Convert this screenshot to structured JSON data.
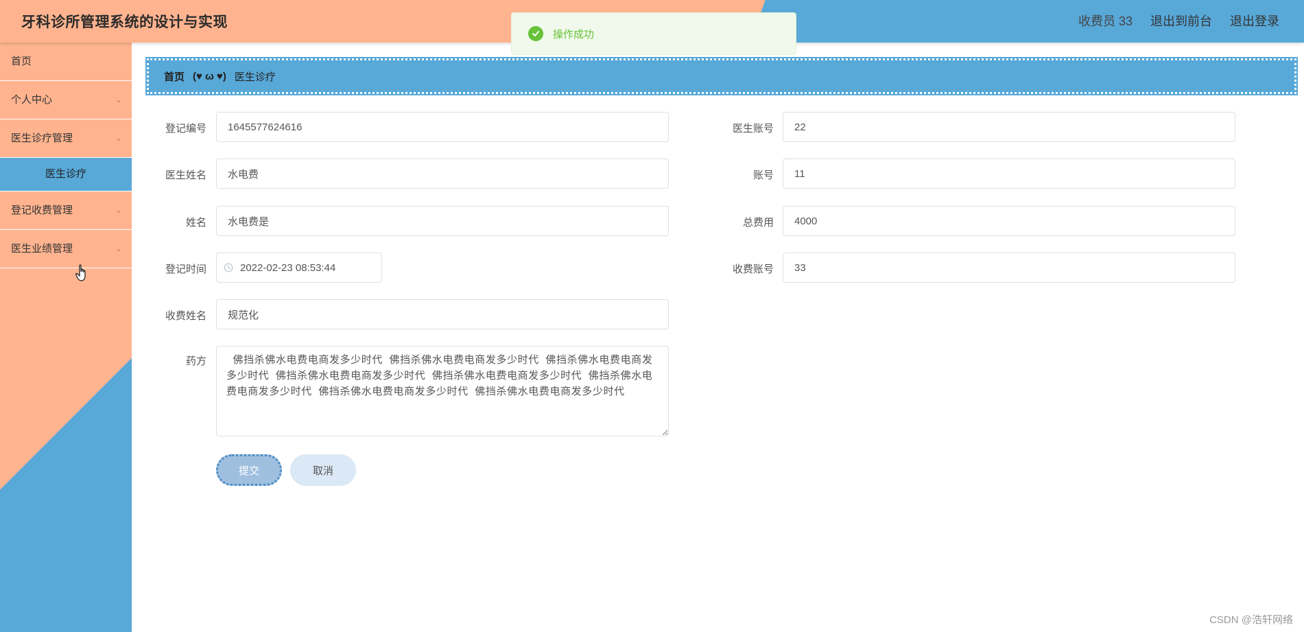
{
  "header": {
    "title": "牙科诊所管理系统的设计与实现",
    "user_label": "收费员 33",
    "back_to_front": "退出到前台",
    "logout": "退出登录"
  },
  "toast": {
    "message": "操作成功"
  },
  "sidebar": {
    "items": [
      {
        "label": "首页"
      },
      {
        "label": "个人中心",
        "chevron": "chevron-down-icon"
      },
      {
        "label": "医生诊疗管理",
        "chevron": "chevron-down-icon",
        "expanded": true
      },
      {
        "label": "登记收费管理",
        "chevron": "chevron-down-icon"
      },
      {
        "label": "医生业绩管理",
        "chevron": "chevron-down-icon"
      }
    ],
    "submenu": {
      "active_label": "医生诊疗"
    }
  },
  "breadcrumb": {
    "home": "首页",
    "separator": "(♥ ω ♥)",
    "current": "医生诊疗"
  },
  "form": {
    "registration_no": {
      "label": "登记编号",
      "value": "1645577624616"
    },
    "doctor_account": {
      "label": "医生账号",
      "value": "22"
    },
    "doctor_name": {
      "label": "医生姓名",
      "value": "水电费"
    },
    "account": {
      "label": "账号",
      "value": "11"
    },
    "name": {
      "label": "姓名",
      "value": "水电费是"
    },
    "total_cost": {
      "label": "总费用",
      "value": "4000"
    },
    "registration_time": {
      "label": "登记时间",
      "value": "2022-02-23 08:53:44"
    },
    "cashier_account": {
      "label": "收费账号",
      "value": "33"
    },
    "cashier_name": {
      "label": "收费姓名",
      "value": "规范化"
    },
    "prescription": {
      "label": "药方",
      "value": "  佛挡杀佛水电费电商发多少时代  佛挡杀佛水电费电商发多少时代  佛挡杀佛水电费电商发多少时代  佛挡杀佛水电费电商发多少时代  佛挡杀佛水电费电商发多少时代  佛挡杀佛水电费电商发多少时代  佛挡杀佛水电费电商发多少时代  佛挡杀佛水电费电商发多少时代"
    },
    "submit_label": "提交",
    "cancel_label": "取消"
  },
  "colors": {
    "peach": "#ffb48f",
    "blue": "#58a8d8",
    "success": "#67c23a"
  },
  "watermark": "CSDN @浩轩网络"
}
